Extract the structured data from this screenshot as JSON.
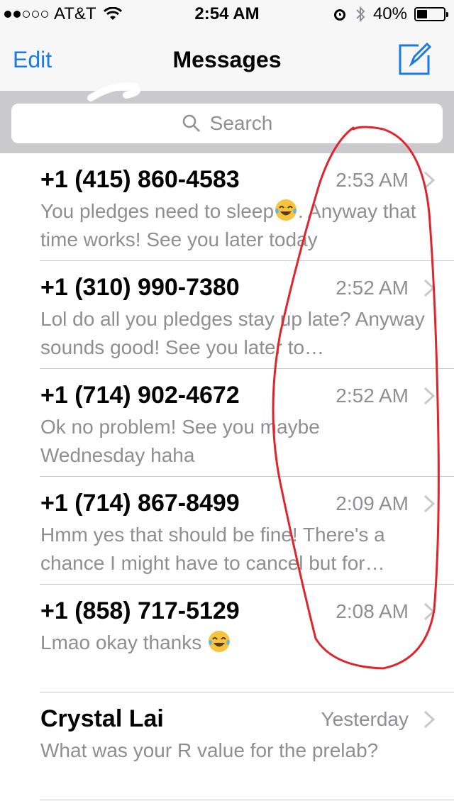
{
  "status_bar": {
    "signal_filled": 2,
    "signal_total": 5,
    "carrier": "AT&T",
    "wifi_icon": "wifi-icon",
    "time": "2:54 AM",
    "alarm_icon": "alarm-icon",
    "bluetooth_icon": "bluetooth-icon",
    "battery_percent": "40%",
    "battery_level": 0.4
  },
  "nav": {
    "edit_label": "Edit",
    "title": "Messages",
    "compose_icon": "compose-icon",
    "accent_color": "#1a7ae6"
  },
  "search": {
    "placeholder": "Search",
    "icon": "search-icon"
  },
  "conversations": [
    {
      "name": "+1 (415) 860-4583",
      "time": "2:53 AM",
      "preview_parts": [
        "You pledges need to sleep",
        "😂",
        ". Anyway that time works! See you later today"
      ]
    },
    {
      "name": "+1 (310) 990-7380",
      "time": "2:52 AM",
      "preview_parts": [
        "Lol do all you pledges  stay up late? Anyway sounds good! See you later to…"
      ]
    },
    {
      "name": "+1 (714) 902-4672",
      "time": "2:52 AM",
      "preview_parts": [
        "Ok no problem! See you maybe Wednesday haha"
      ]
    },
    {
      "name": "+1 (714) 867-8499",
      "time": "2:09 AM",
      "preview_parts": [
        "Hmm yes that should be  fine! There's a chance I might have to cancel but for…"
      ]
    },
    {
      "name": "+1 (858) 717-5129",
      "time": "2:08 AM",
      "preview_parts": [
        "Lmao okay thanks ",
        "😂"
      ]
    },
    {
      "name": "Crystal Lai",
      "time": "Yesterday",
      "preview_parts": [
        "What was your R value for the prelab?"
      ]
    }
  ],
  "annotation": {
    "color": "#e0242b",
    "shape": "hand-drawn oval around timestamps"
  }
}
